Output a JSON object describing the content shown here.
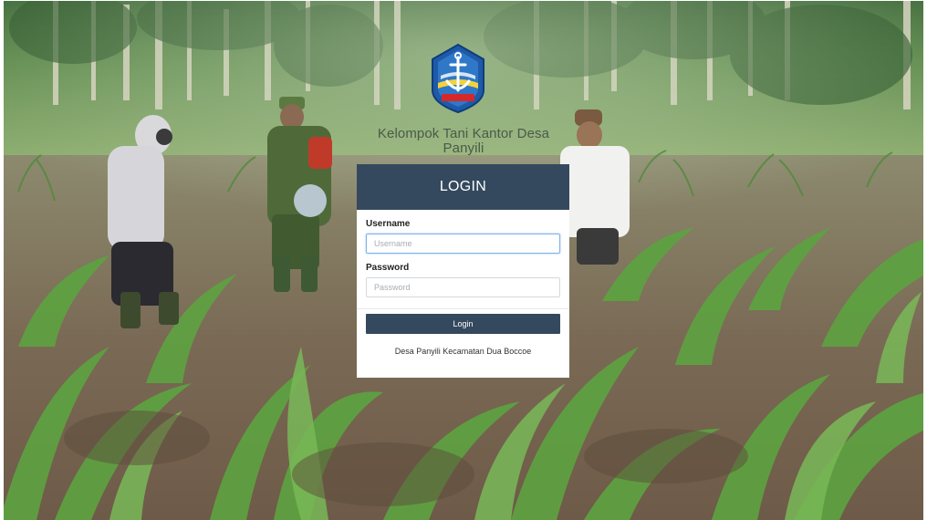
{
  "header": {
    "app_title": "Kelompok Tani Kantor Desa Panyili"
  },
  "logo": {
    "icon": "anchor-shield-emblem",
    "banner_text": "KABUPATEN BONE"
  },
  "login_card": {
    "title": "LOGIN",
    "username_label": "Username",
    "username_placeholder": "Username",
    "username_value": "",
    "password_label": "Password",
    "password_placeholder": "Password",
    "password_value": "",
    "submit_label": "Login",
    "footer": "Desa Panyili Kecamatan Dua Boccoe"
  },
  "colors": {
    "header_bg": "#34495e",
    "button_bg": "#34495e",
    "card_bg": "#ffffff",
    "title_text": "#4b5a48",
    "focus_border": "#7fb3e6"
  }
}
